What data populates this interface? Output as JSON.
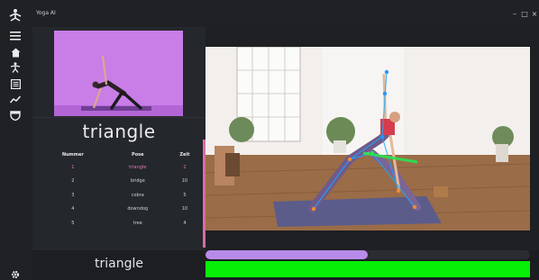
{
  "window": {
    "title": "Yoga AI",
    "minimize": "–",
    "maximize": "□",
    "close": "×"
  },
  "sidebar": {
    "icons": [
      "yoga-logo-icon",
      "menu-icon",
      "home-icon",
      "exercise-icon",
      "list-icon",
      "chart-icon",
      "shield-icon",
      "settings-icon"
    ]
  },
  "panel": {
    "current_pose": "triangle",
    "table": {
      "headers": [
        "Nummer",
        "Pose",
        "Zeit"
      ],
      "rows": [
        [
          "1",
          "triangle",
          "2"
        ],
        [
          "2",
          "bridge",
          "10"
        ],
        [
          "3",
          "cobra",
          "5"
        ],
        [
          "4",
          "downdog",
          "10"
        ],
        [
          "5",
          "tree",
          "4"
        ]
      ],
      "active_row": 0
    }
  },
  "bottom": {
    "pose_label": "triangle",
    "progress_fraction": 0.5
  },
  "colors": {
    "accent_pink": "#e777b6",
    "progress": "#b88be8",
    "match_green": "#07ee07",
    "thumbnail_bg": "#c97de6"
  }
}
